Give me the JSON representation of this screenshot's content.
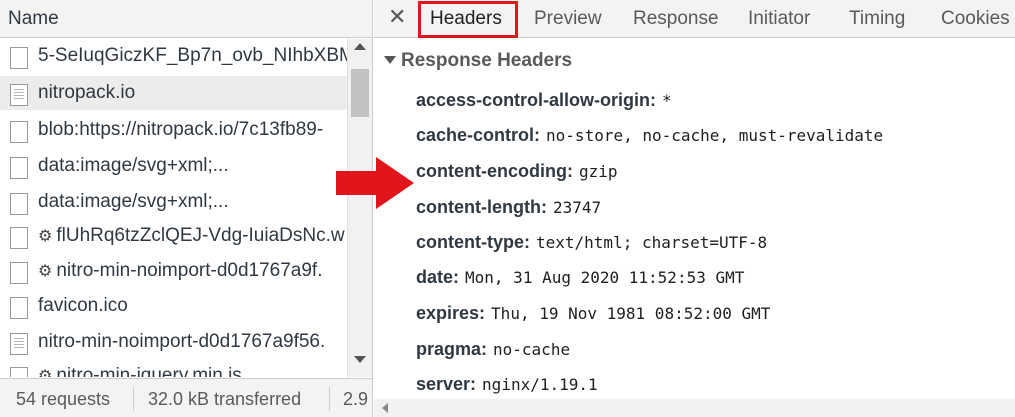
{
  "request_list": {
    "column_header": "Name",
    "items": [
      {
        "icon": "file-icon",
        "label": "5-SeIuqGiczKF_Bp7n_ovb_NIhbXBM",
        "selected": false
      },
      {
        "icon": "document-icon",
        "label": "nitropack.io",
        "selected": true
      },
      {
        "icon": "file-icon",
        "label": "blob:https://nitropack.io/7c13fb89-",
        "selected": false
      },
      {
        "icon": "file-icon",
        "label": "data:image/svg+xml;...",
        "selected": false
      },
      {
        "icon": "file-icon",
        "label": "data:image/svg+xml;...",
        "selected": false
      },
      {
        "icon": "file-icon",
        "prefix_icon": "gear-icon",
        "label": "flUhRq6tzZclQEJ-Vdg-IuiaDsNc.w",
        "selected": false
      },
      {
        "icon": "file-icon",
        "prefix_icon": "gear-icon",
        "label": "nitro-min-noimport-d0d1767a9f.",
        "selected": false
      },
      {
        "icon": "file-icon",
        "label": "favicon.ico",
        "selected": false
      },
      {
        "icon": "document-icon",
        "label": "nitro-min-noimport-d0d1767a9f56.",
        "selected": false
      },
      {
        "icon": "file-icon",
        "prefix_icon": "gear-icon",
        "label": "nitro-min-jquery.min.js",
        "selected": false
      }
    ]
  },
  "status_bar": {
    "requests": "54 requests",
    "transferred": "32.0 kB transferred",
    "resources": "2.9"
  },
  "tabs": {
    "close_symbol": "✕",
    "items": [
      {
        "label": "Headers",
        "active": true
      },
      {
        "label": "Preview",
        "active": false
      },
      {
        "label": "Response",
        "active": false
      },
      {
        "label": "Initiator",
        "active": false
      },
      {
        "label": "Timing",
        "active": false
      },
      {
        "label": "Cookies",
        "active": false
      }
    ]
  },
  "response_headers": {
    "title": "Response Headers",
    "headers": [
      {
        "name": "access-control-allow-origin:",
        "value": "*"
      },
      {
        "name": "cache-control:",
        "value": "no-store, no-cache, must-revalidate"
      },
      {
        "name": "content-encoding:",
        "value": "gzip"
      },
      {
        "name": "content-length:",
        "value": "23747"
      },
      {
        "name": "content-type:",
        "value": "text/html; charset=UTF-8"
      },
      {
        "name": "date:",
        "value": "Mon, 31 Aug 2020 11:52:53 GMT"
      },
      {
        "name": "expires:",
        "value": "Thu, 19 Nov 1981 08:52:00 GMT"
      },
      {
        "name": "pragma:",
        "value": "no-cache"
      },
      {
        "name": "server:",
        "value": "nginx/1.19.1"
      }
    ]
  },
  "colors": {
    "highlight_border": "#e0161c",
    "arrow": "#e0161c",
    "selected_row": "#ececec",
    "toolbar_bg": "#f3f3f3"
  }
}
